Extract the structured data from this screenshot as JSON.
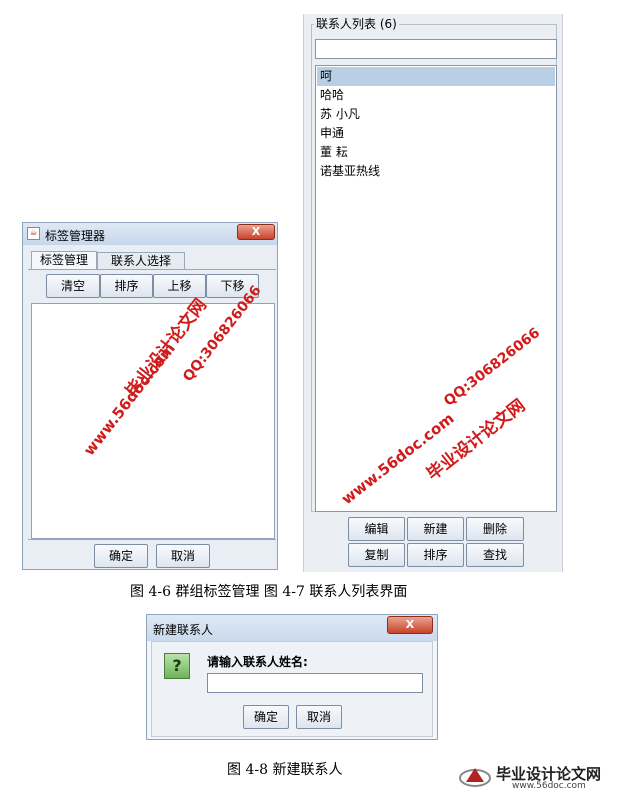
{
  "tag_manager": {
    "title": "标签管理器",
    "close_glyph": "X",
    "tabs": [
      "标签管理",
      "联系人选择"
    ],
    "toolbar": [
      "清空",
      "排序",
      "上移",
      "下移"
    ],
    "footer": {
      "ok": "确定",
      "cancel": "取消"
    }
  },
  "contact_list": {
    "legend": "联系人列表 (6)",
    "search_value": "",
    "items": [
      "呵",
      "哈哈",
      "苏 小凡",
      "申通",
      "董 耘",
      "诺基亚热线"
    ],
    "selected_index": 0,
    "buttons_row1": [
      "编辑",
      "新建",
      "删除"
    ],
    "buttons_row2": [
      "复制",
      "排序",
      "查找"
    ]
  },
  "captions": {
    "fig_4_6_7": "图 4-6 群组标签管理   图 4-7 联系人列表界面",
    "fig_4_8": "图 4-8 新建联系人"
  },
  "new_contact": {
    "title": "新建联系人",
    "close_glyph": "X",
    "icon_glyph": "?",
    "prompt": "请输入联系人姓名:",
    "input_value": "",
    "ok": "确定",
    "cancel": "取消"
  },
  "watermarks": {
    "site_name": "毕业设计论文网",
    "url": "www.56doc.com",
    "qq": "QQ:306826066"
  },
  "logo": {
    "name": "毕业设计论文网",
    "url": "www.56doc.com"
  },
  "colors": {
    "watermark": "#d11b1b",
    "selection": "#b8cfe5",
    "close_button": "#c8432a"
  }
}
